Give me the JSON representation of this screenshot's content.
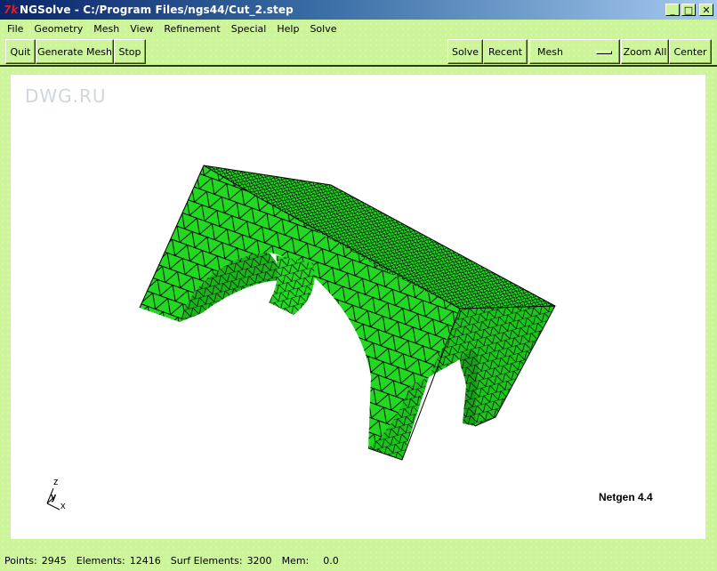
{
  "window": {
    "title": "NGSolve - C:/Program Files/ngs44/Cut_2.step",
    "logo_icon": "tk-feather-icon",
    "logo_glyph": "7k",
    "controls": [
      {
        "name": "minimize",
        "glyph": "_"
      },
      {
        "name": "maximize",
        "glyph": "□"
      },
      {
        "name": "close",
        "glyph": "✕"
      }
    ]
  },
  "menu": [
    "File",
    "Geometry",
    "Mesh",
    "View",
    "Refinement",
    "Special",
    "Help",
    "Solve"
  ],
  "toolbar": {
    "left": [
      "Quit",
      "Generate Mesh",
      "Stop"
    ],
    "right": {
      "solve": "Solve",
      "recent": "Recent",
      "view_select": "Mesh",
      "zoom_all": "Zoom All",
      "center": "Center"
    }
  },
  "viewport": {
    "watermark": "DWG.RU",
    "brand": "Netgen 4.4",
    "axes": {
      "x": "x",
      "y": "y",
      "z": "z"
    },
    "mesh_color": "#22d822",
    "mesh_line_color": "#000000"
  },
  "status": {
    "points_label": "Points:",
    "points": "2945",
    "elements_label": "Elements:",
    "elements": "12416",
    "surf_elements_label": "Surf Elements:",
    "surf_elements": "3200",
    "mem_label": "Mem:",
    "mem": "0.0"
  }
}
